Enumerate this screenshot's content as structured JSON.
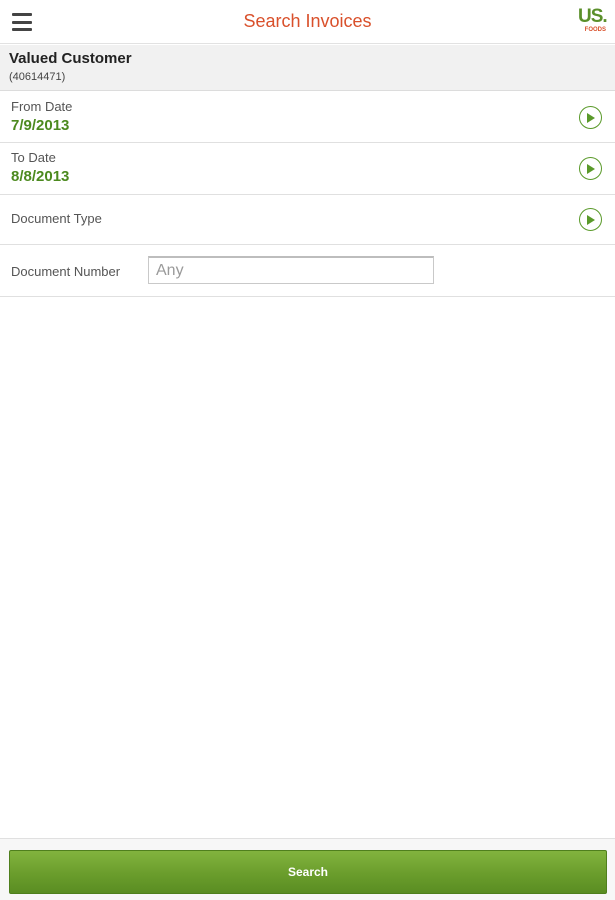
{
  "header": {
    "title": "Search Invoices",
    "menu_icon": "hamburger-menu-icon",
    "logo": {
      "main": "US.",
      "sub": "FOODS"
    }
  },
  "customer": {
    "name": "Valued Customer",
    "id": "(40614471)"
  },
  "fields": {
    "from_date": {
      "label": "From Date",
      "value": "7/9/2013"
    },
    "to_date": {
      "label": "To Date",
      "value": "8/8/2013"
    },
    "document_type": {
      "label": "Document Type"
    },
    "document_number": {
      "label": "Document Number",
      "value": "",
      "placeholder": "Any"
    }
  },
  "actions": {
    "search_label": "Search"
  },
  "colors": {
    "title": "#d9502b",
    "accent_green": "#4c8a1f",
    "button_green": "#6a9d2c"
  }
}
